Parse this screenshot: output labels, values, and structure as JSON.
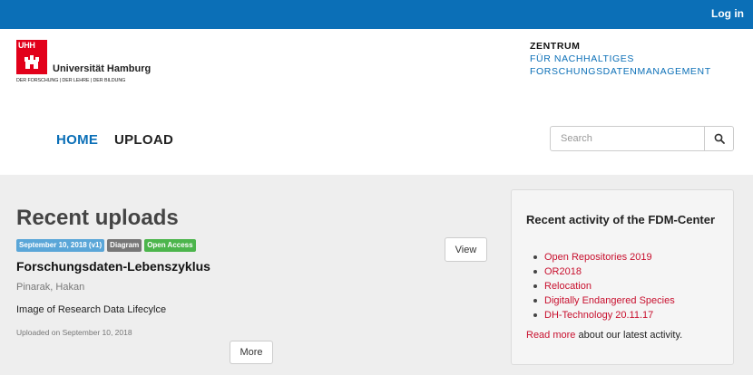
{
  "header": {
    "login_label": "Log in"
  },
  "logo": {
    "letters": "UHH",
    "university_name": "Universität Hamburg",
    "tagline": "DER FORSCHUNG | DER LEHRE | DER BILDUNG"
  },
  "fdm": {
    "line1": "ZENTRUM",
    "line2": "FÜR NACHHALTIGES",
    "line3": "FORSCHUNGSDATENMANAGEMENT"
  },
  "nav": {
    "home": "HOME",
    "upload": "UPLOAD"
  },
  "search": {
    "placeholder": "Search",
    "icon": "search-icon"
  },
  "recent": {
    "title": "Recent uploads",
    "item": {
      "badge_date": "September 10, 2018 (v1)",
      "badge_type": "Diagram",
      "badge_access": "Open Access",
      "title": "Forschungsdaten-Lebenszyklus",
      "author": "Pinarak, Hakan",
      "description": "Image of Research Data Lifecylce",
      "uploaded": "Uploaded on September 10, 2018",
      "view_label": "View",
      "more_label": "More"
    }
  },
  "sidebar": {
    "title": "Recent activity of the FDM-Center",
    "items": [
      "Open Repositories 2019",
      "OR2018",
      "Relocation",
      "Digitally Endangered Species",
      "DH-Technology 20.11.17"
    ],
    "read_more_link": "Read more",
    "read_more_text": "about our latest activity."
  },
  "colors": {
    "brand_blue": "#0b6fb7",
    "uhh_red": "#e2001a",
    "link_red": "#c8102e",
    "badge_blue": "#5aa6d8",
    "badge_gray": "#777777",
    "badge_green": "#4cb54c"
  }
}
